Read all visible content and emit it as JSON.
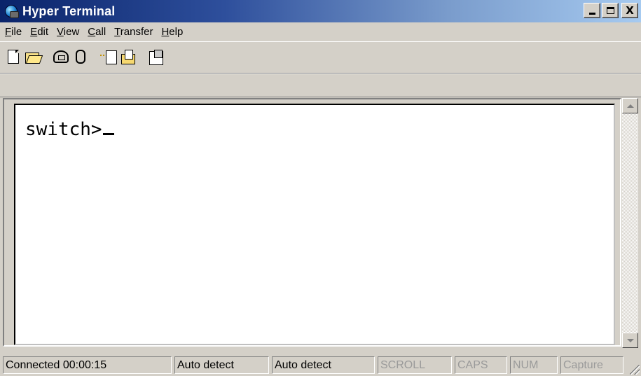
{
  "window": {
    "title": "Hyper Terminal",
    "icon": "hyperterminal-app-icon"
  },
  "title_buttons": {
    "minimize": "_",
    "maximize": "□",
    "close": "X"
  },
  "menu": {
    "items": [
      {
        "label": "File",
        "underline": "F",
        "rest": "ile"
      },
      {
        "label": "Edit",
        "underline": "E",
        "rest": "dit"
      },
      {
        "label": "View",
        "underline": "V",
        "rest": "iew"
      },
      {
        "label": "Call",
        "underline": "C",
        "rest": "all"
      },
      {
        "label": "Transfer",
        "underline": "T",
        "rest": "ransfer"
      },
      {
        "label": "Help",
        "underline": "H",
        "rest": "elp"
      }
    ]
  },
  "toolbar": {
    "icons": [
      "new-file-icon",
      "open-folder-icon",
      "dial-phone-icon",
      "disconnect-phone-icon",
      "send-file-icon",
      "receive-file-icon",
      "properties-icon"
    ]
  },
  "terminal": {
    "prompt": "switch>"
  },
  "status": {
    "connected": "Connected 00:00:15",
    "detect1": "Auto detect",
    "detect2": "Auto detect",
    "scroll": "SCROLL",
    "caps": "CAPS",
    "num": "NUM",
    "capture": "Capture"
  }
}
